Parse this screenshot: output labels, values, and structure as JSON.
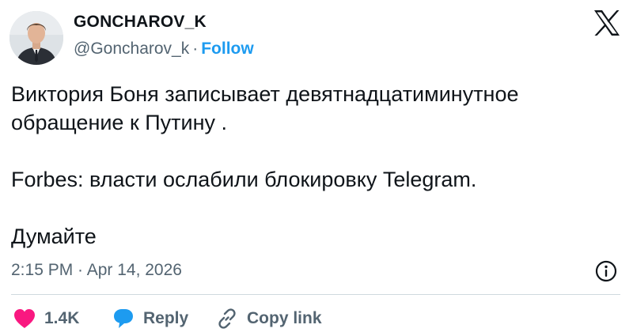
{
  "author": {
    "display_name": "GONCHAROV_K",
    "handle": "@Goncharov_k",
    "separator": "·",
    "follow_label": "Follow"
  },
  "post": {
    "lines": [
      "Виктория Боня записывает девятнадцатиминутное",
      "обращение к Путину .",
      "Forbes: власти ослабили блокировку Telegram.",
      "Думайте"
    ],
    "timestamp": "2:15 PM · Apr 14, 2026"
  },
  "actions": {
    "like_count": "1.4K",
    "reply_label": "Reply",
    "copy_link_label": "Copy link"
  },
  "icons": {
    "brand": "x-logo-icon",
    "info": "info-icon",
    "like": "heart-icon",
    "reply": "speech-bubble-icon",
    "copy": "link-icon"
  },
  "colors": {
    "accent": "#1d9bf0",
    "like": "#f91880",
    "text": "#0f1419",
    "muted": "#536471",
    "divider": "#cfd9de"
  }
}
